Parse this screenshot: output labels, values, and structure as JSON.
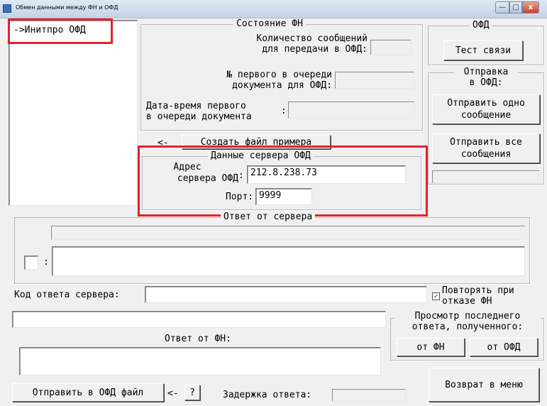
{
  "window": {
    "title": "Обмен данными между ФН и ОФД",
    "minimize_icon": "minimize-icon",
    "maximize_icon": "maximize-icon",
    "close_glyph": "x"
  },
  "left_list": {
    "items": [
      "->Инитпро ОФД"
    ]
  },
  "fn_state": {
    "legend": "Состояние ФН",
    "msg_count_label_1": "Количество сообщений",
    "msg_count_label_2": "для передачи в ОФД:",
    "msg_count_value": "",
    "first_doc_label_1": "№ первого в очереди",
    "first_doc_label_2": "документа для ОФД:",
    "first_doc_value": "",
    "datetime_label_1": "Дата-время первого",
    "datetime_label_2": "в очереди документа",
    "colon": ":",
    "datetime_value": ""
  },
  "sample": {
    "arrow": "<-",
    "create_file_label": "Создать файл примера"
  },
  "ofd_server": {
    "legend": "Данные сервера ОФД",
    "address_label_1": "Адрес",
    "address_label_2": "сервера ОФД",
    "colon": ":",
    "address_value": "212.8.238.73",
    "port_label": "Порт:",
    "port_value": "9999"
  },
  "ofd_panel": {
    "legend": "ОФД",
    "test_button": "Тест связи",
    "send_legend_1": "Отправка",
    "send_legend_2": "в ОФД:",
    "send_one_1": "Отправить одно",
    "send_one_2": "сообщение",
    "send_all_1": "Отправить все",
    "send_all_2": "сообщения"
  },
  "server_response": {
    "legend": "Ответ от сервера",
    "colon": ":"
  },
  "response_code": {
    "label": "Код ответа сервера:",
    "value": "",
    "repeat_label_1": "Повторять при",
    "repeat_label_2": "отказе ФН",
    "repeat_checked": true
  },
  "last_response": {
    "legend_1": "Просмотр последнего",
    "legend_2": "ответа, полученного:",
    "from_fn": "от ФН",
    "from_ofd": "от ОФД"
  },
  "fn_response": {
    "label": "Ответ от ФН:"
  },
  "bottom": {
    "send_file": "Отправить в ОФД файл",
    "arrow": "<-",
    "help": "?",
    "delay_label": "Задержка ответа:",
    "back_button": "Возврат в меню"
  },
  "colors": {
    "highlight": "#e4222c",
    "window_bg": "#f0f0f0"
  }
}
